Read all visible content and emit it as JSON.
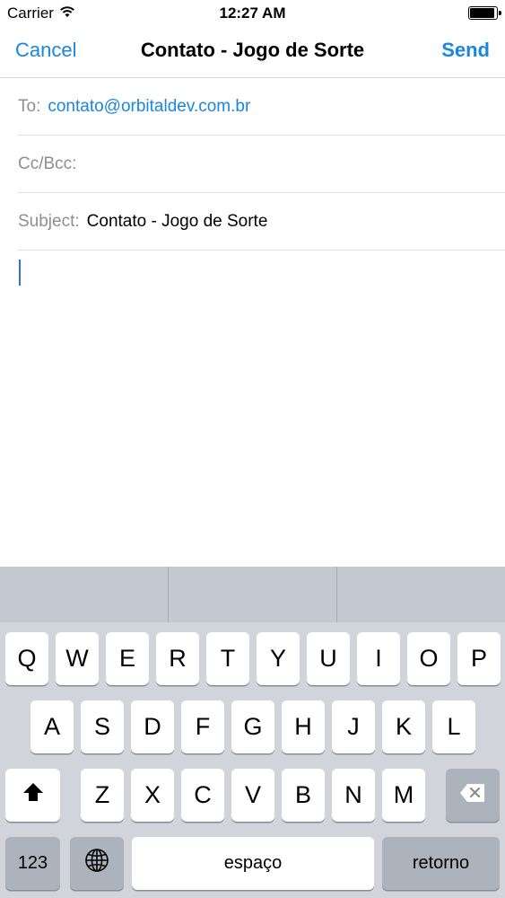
{
  "status_bar": {
    "carrier": "Carrier",
    "time": "12:27 AM",
    "battery_level": 0.95
  },
  "nav": {
    "cancel_label": "Cancel",
    "title": "Contato - Jogo de Sorte",
    "send_label": "Send"
  },
  "fields": {
    "to_label": "To:",
    "to_value": "contato@orbitaldev.com.br",
    "cc_label": "Cc/Bcc:",
    "subject_label": "Subject:",
    "subject_value": "Contato - Jogo de Sorte"
  },
  "keyboard": {
    "row1": [
      "Q",
      "W",
      "E",
      "R",
      "T",
      "Y",
      "U",
      "I",
      "O",
      "P"
    ],
    "row2": [
      "A",
      "S",
      "D",
      "F",
      "G",
      "H",
      "J",
      "K",
      "L"
    ],
    "row3": [
      "Z",
      "X",
      "C",
      "V",
      "B",
      "N",
      "M"
    ],
    "numbers_label": "123",
    "space_label": "espaço",
    "return_label": "retorno"
  },
  "colors": {
    "accent": "#1a86e0",
    "cursor": "#2f6fde",
    "keyboard_bg": "#d1d4da"
  }
}
